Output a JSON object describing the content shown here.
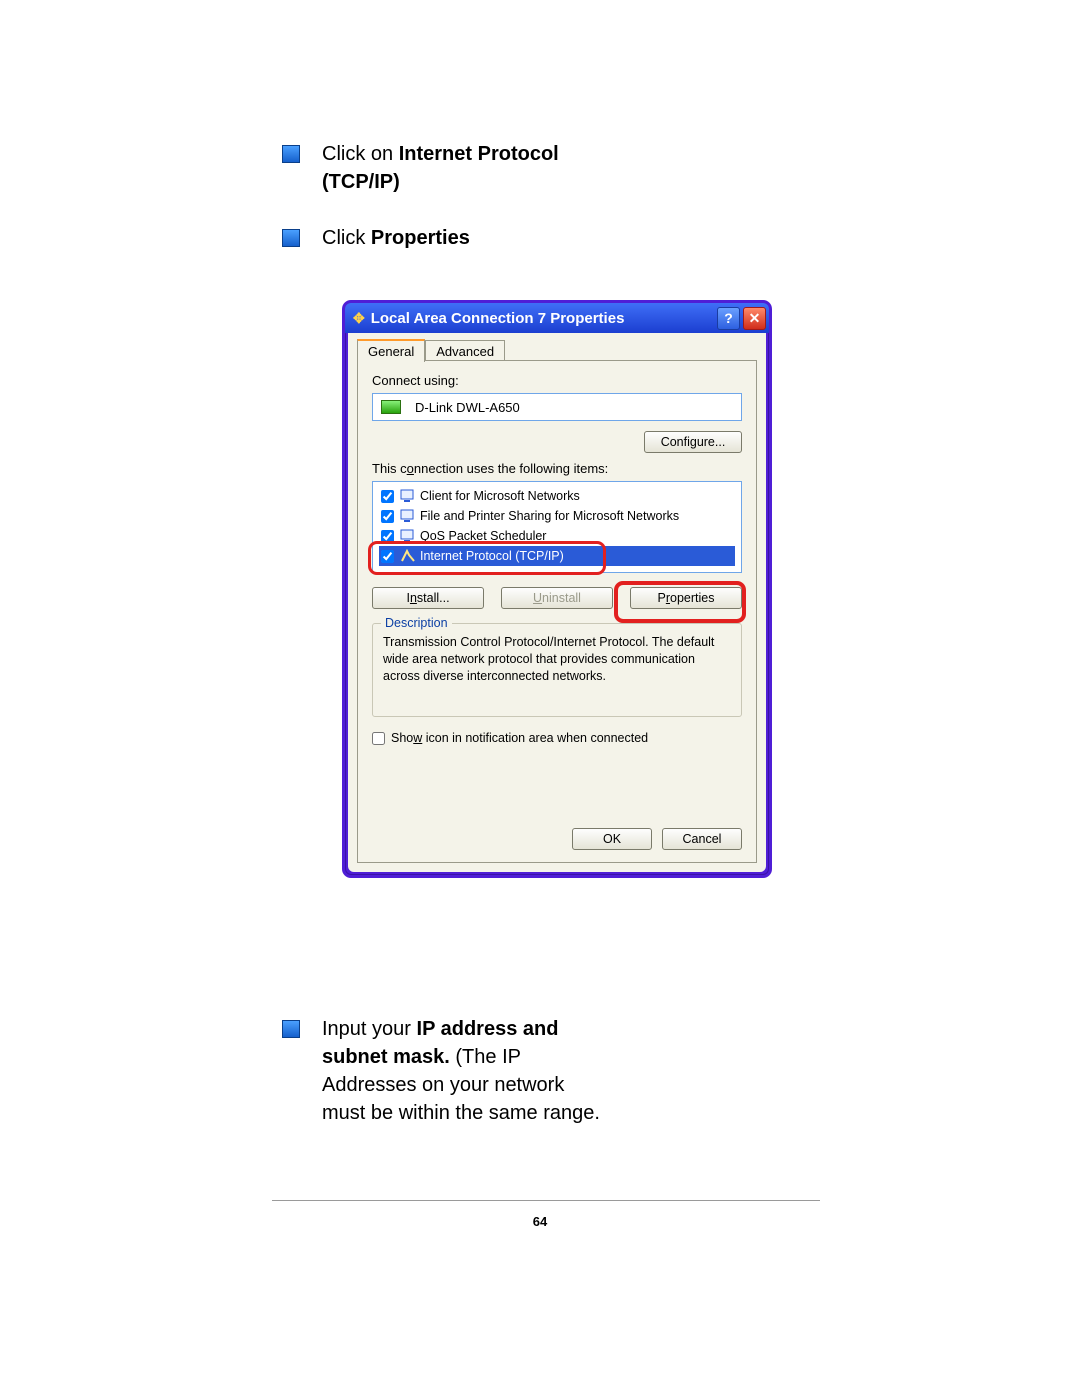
{
  "page_number": "64",
  "bullets_top": [
    {
      "pre": "Click on ",
      "bold": "Internet Protocol (TCP/IP)",
      "post": ""
    },
    {
      "pre": "Click ",
      "bold": "Properties",
      "post": ""
    }
  ],
  "bullets_bottom": [
    {
      "pre": "Input your ",
      "bold": "IP address and subnet mask.",
      "post": " (The IP Addresses on your network must be within the same range."
    }
  ],
  "dialog": {
    "title": "Local Area Connection 7 Properties",
    "tabs": {
      "general": "General",
      "advanced": "Advanced"
    },
    "connect_using_label": "Connect using:",
    "adapter": "D-Link DWL-A650",
    "configure_btn": "Configure...",
    "items_label": "This connection uses the following items:",
    "items": [
      {
        "checked": true,
        "label": "Client for Microsoft Networks"
      },
      {
        "checked": true,
        "label": "File and Printer Sharing for Microsoft Networks"
      },
      {
        "checked": true,
        "label": "QoS Packet Scheduler"
      },
      {
        "checked": true,
        "label": "Internet Protocol (TCP/IP)",
        "selected": true
      }
    ],
    "install_btn": "Install...",
    "uninstall_btn": "Uninstall",
    "properties_btn": "Properties",
    "description_title": "Description",
    "description_text": "Transmission Control Protocol/Internet Protocol. The default wide area network protocol that provides communication across diverse interconnected networks.",
    "show_icon": "Show icon in notification area when connected",
    "ok_btn": "OK",
    "cancel_btn": "Cancel"
  }
}
